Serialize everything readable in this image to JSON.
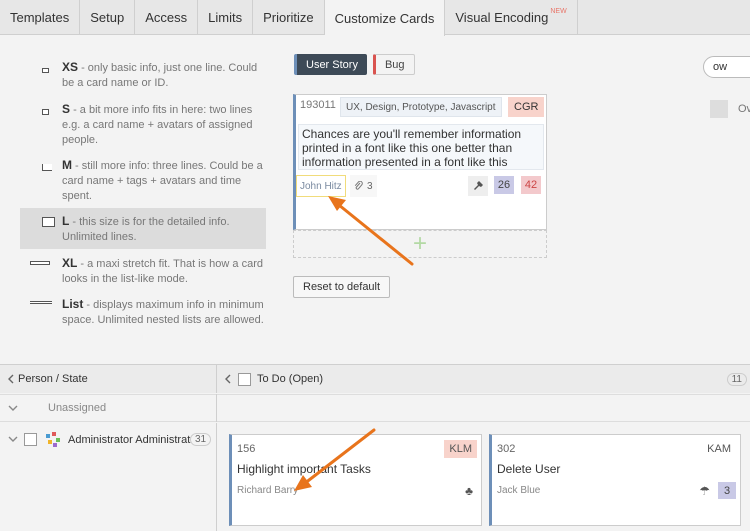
{
  "tabs": [
    {
      "label": "Templates"
    },
    {
      "label": "Setup"
    },
    {
      "label": "Access"
    },
    {
      "label": "Limits"
    },
    {
      "label": "Prioritize"
    },
    {
      "label": "Customize Cards"
    },
    {
      "label": "Visual Encoding",
      "badge": "NEW"
    }
  ],
  "sizes": [
    {
      "name": "XS",
      "desc": " - only basic info, just one line. Could be a card name or ID."
    },
    {
      "name": "S",
      "desc": " - a bit more info fits in here: two lines e.g. a card name + avatars of assigned people."
    },
    {
      "name": "M",
      "desc": " - still more info: three lines. Could be a card name + tags + avatars and time spent."
    },
    {
      "name": "L",
      "desc": " - this size is for the detailed info. Unlimited lines."
    },
    {
      "name": "XL",
      "desc": " - a maxi stretch fit. That is how a card looks in the list-like mode."
    },
    {
      "name": "List",
      "desc": " - displays maximum info in minimum space. Unlimited nested lists are allowed."
    }
  ],
  "type_tabs": {
    "user_story": "User Story",
    "bug": "Bug"
  },
  "preview_card": {
    "id": "193011",
    "tags": "UX, Design, Prototype, Javascript",
    "owner": "CGR",
    "name": "Chances are you'll remember information printed in a font like this one better than information presented in a font like this",
    "user": "John Hitz",
    "attachments": "3",
    "num1": "26",
    "num2": "42",
    "add_glyph": "+"
  },
  "reset_label": "Reset to default",
  "search_value": "ow",
  "right_cutoff_text": "Ov",
  "board": {
    "header_left": "Person / State",
    "header_right": "To Do (Open)",
    "header_count": "11",
    "unassigned": "Unassigned",
    "admin_name": "Administrator Administrator",
    "admin_count": "31",
    "cards": [
      {
        "id": "156",
        "owner": "KLM",
        "title": "Highlight important Tasks",
        "user": "Richard Barry",
        "icon": "clover-icon"
      },
      {
        "id": "302",
        "owner": "KAM",
        "title": "Delete User",
        "user": "Jack Blue",
        "icon": "umbrella-icon",
        "num": "3"
      }
    ]
  },
  "colors": {
    "accent": "#6d8fb8",
    "arrow": "#e8741c",
    "owner_pink": "#f8d3cb",
    "num_blue": "#c9c9e6",
    "num_pink": "#f3c9cc"
  }
}
